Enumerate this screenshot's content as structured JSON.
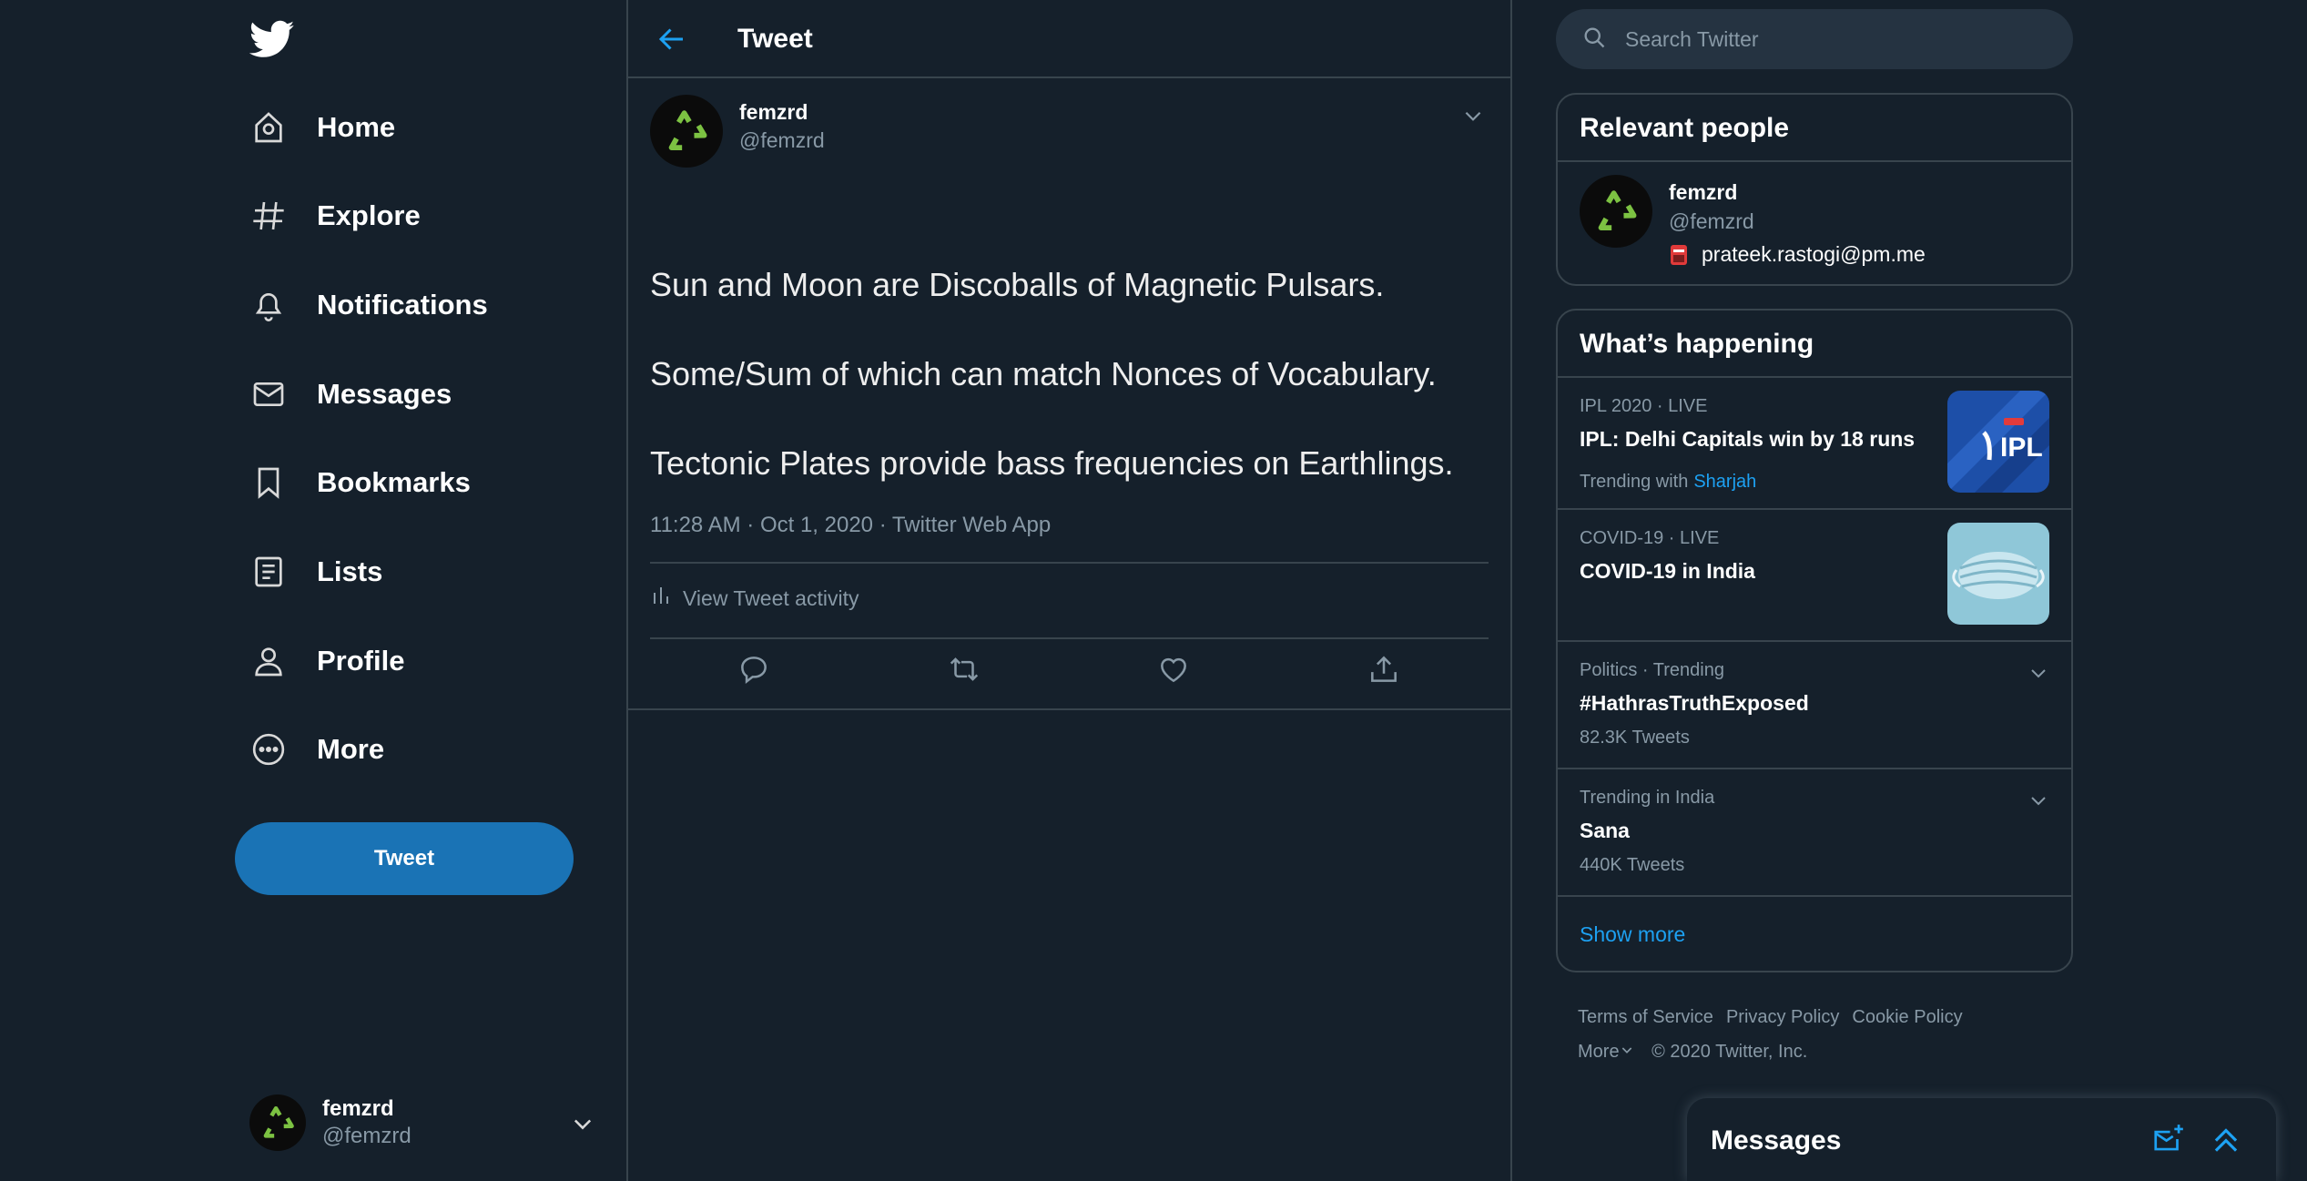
{
  "colors": {
    "background": "#15202b",
    "border": "#38444d",
    "accent": "#1da1f2",
    "tweet_button": "#1a73b5",
    "muted": "#8899a6"
  },
  "sidebar": {
    "logo": "twitter-bird-icon",
    "items": [
      {
        "label": "Home",
        "icon": "home-icon"
      },
      {
        "label": "Explore",
        "icon": "hashtag-icon"
      },
      {
        "label": "Notifications",
        "icon": "bell-icon"
      },
      {
        "label": "Messages",
        "icon": "envelope-icon"
      },
      {
        "label": "Bookmarks",
        "icon": "bookmark-icon"
      },
      {
        "label": "Lists",
        "icon": "list-icon"
      },
      {
        "label": "Profile",
        "icon": "person-icon"
      },
      {
        "label": "More",
        "icon": "more-circle-icon"
      }
    ],
    "tweet_button": "Tweet",
    "account": {
      "name": "femzrd",
      "handle": "@femzrd"
    }
  },
  "main": {
    "header_title": "Tweet",
    "tweet": {
      "author_name": "femzrd",
      "author_handle": "@femzrd",
      "lines": [
        "Sun and Moon are Discoballs of Magnetic Pulsars.",
        "Some/Sum of which can match Nonces of Vocabulary.",
        "Tectonic Plates provide bass frequencies on Earthlings."
      ],
      "meta": "11:28 AM · Oct 1, 2020 · Twitter Web App",
      "activity_label": "View Tweet activity"
    }
  },
  "right": {
    "search_placeholder": "Search Twitter",
    "relevant_people": {
      "title": "Relevant people",
      "name": "femzrd",
      "handle": "@femzrd",
      "bio": "prateek.rastogi@pm.me"
    },
    "whats_happening": {
      "title": "What’s happening",
      "trends": [
        {
          "context": "IPL 2020 · LIVE",
          "title": "IPL: Delhi Capitals win by 18 runs",
          "sub_prefix": "Trending with",
          "sub_link": "Sharjah",
          "thumb": "ipl-logo"
        },
        {
          "context": "COVID-19 · LIVE",
          "title": "COVID-19 in India",
          "thumb": "face-mask-image"
        },
        {
          "context": "Politics · Trending",
          "title": "#HathrasTruthExposed",
          "count": "82.3K Tweets"
        },
        {
          "context": "Trending in India",
          "title": "Sana",
          "count": "440K Tweets"
        }
      ],
      "show_more": "Show more"
    },
    "footer": {
      "links": [
        "Terms of Service",
        "Privacy Policy",
        "Cookie Policy"
      ],
      "more": "More",
      "copyright": "© 2020 Twitter, Inc."
    }
  },
  "drawer": {
    "title": "Messages"
  }
}
